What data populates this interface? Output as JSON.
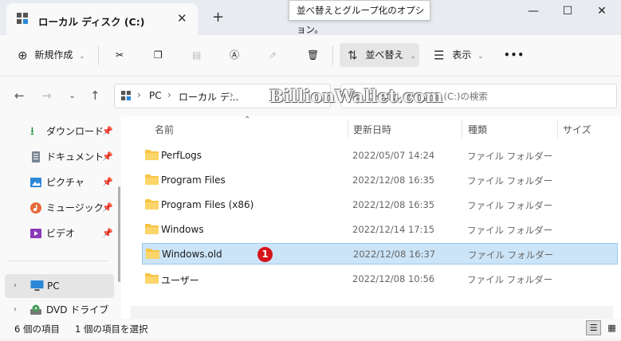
{
  "tab": {
    "title": "ローカル ディスク (C:)"
  },
  "tooltip": "並べ替えとグループ化のオプション。",
  "toolbar": {
    "new_label": "新規作成",
    "sort_label": "並べ替え",
    "view_label": "表示",
    "more_label": "•••"
  },
  "address": {
    "pc": "PC",
    "drive": "ローカル デ..."
  },
  "search": {
    "placeholder": "ローカル ディスク (C:)の検索"
  },
  "sidebar": {
    "items": [
      {
        "label": "ダウンロード",
        "icon": "download-icon"
      },
      {
        "label": "ドキュメント",
        "icon": "document-icon"
      },
      {
        "label": "ピクチャ",
        "icon": "pictures-icon"
      },
      {
        "label": "ミュージック",
        "icon": "music-icon"
      },
      {
        "label": "ビデオ",
        "icon": "video-icon"
      },
      {
        "label": "PC",
        "icon": "pc-icon"
      },
      {
        "label": "DVD ドライブ (D:)",
        "icon": "dvd-drive-icon"
      }
    ]
  },
  "columns": {
    "name": "名前",
    "date": "更新日時",
    "type": "種類",
    "size": "サイズ"
  },
  "files": [
    {
      "name": "PerfLogs",
      "date": "2022/05/07 14:24",
      "type": "ファイル フォルダー"
    },
    {
      "name": "Program Files",
      "date": "2022/12/08 16:35",
      "type": "ファイル フォルダー"
    },
    {
      "name": "Program Files (x86)",
      "date": "2022/12/08 16:35",
      "type": "ファイル フォルダー"
    },
    {
      "name": "Windows",
      "date": "2022/12/14 17:15",
      "type": "ファイル フォルダー"
    },
    {
      "name": "Windows.old",
      "date": "2022/12/08 16:37",
      "type": "ファイル フォルダー"
    },
    {
      "name": "ユーザー",
      "date": "2022/12/08 10:56",
      "type": "ファイル フォルダー"
    }
  ],
  "badge": "1",
  "status": {
    "count": "6 個の項目",
    "selected": "1 個の項目を選択"
  },
  "watermark": "BillionWallet.com",
  "colors": {
    "selection": "#cce4f7",
    "folder": "#f8c444",
    "badge": "#d7141a"
  }
}
